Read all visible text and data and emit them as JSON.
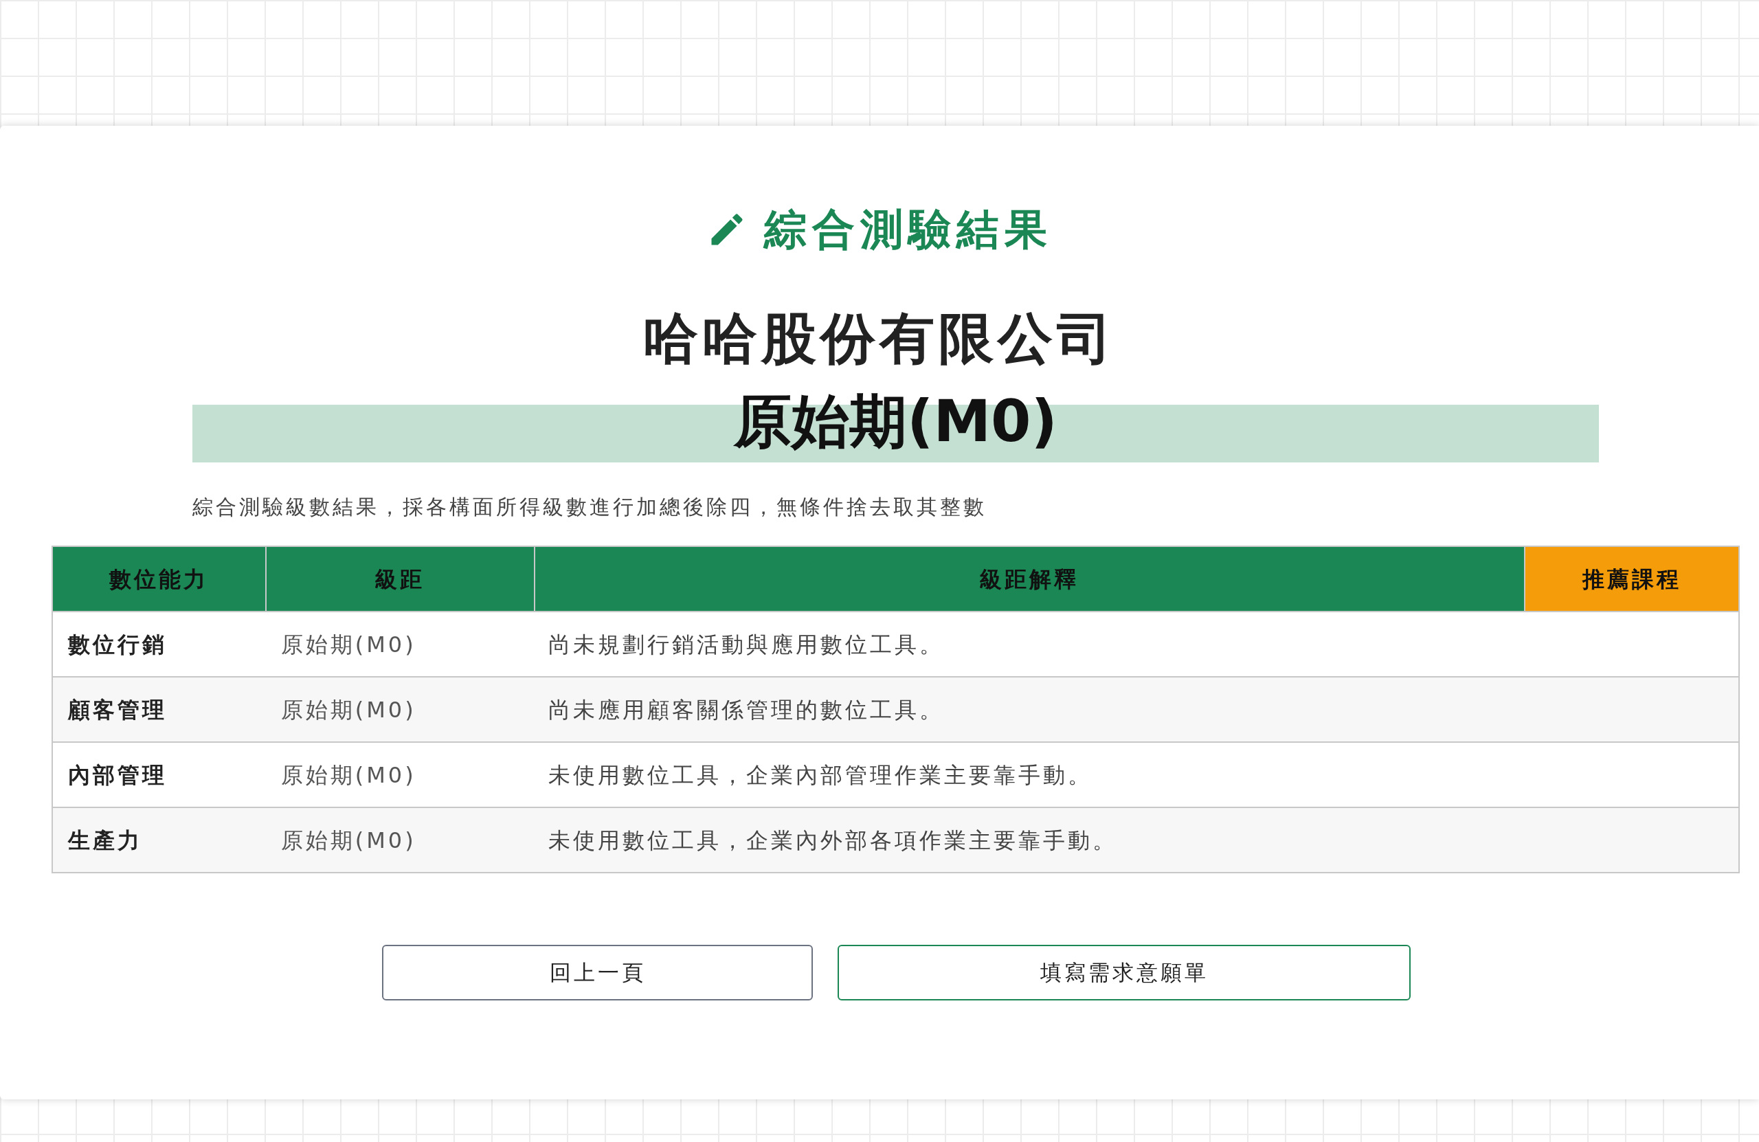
{
  "heading": {
    "title": "綜合測驗結果"
  },
  "company": "哈哈股份有限公司",
  "level": "原始期(M0)",
  "note": "綜合測驗級數結果，採各構面所得級數進行加總後除四，無條件捨去取其整數",
  "table": {
    "columns": [
      {
        "label": "數位能力",
        "color": "#1b8754"
      },
      {
        "label": "級距",
        "color": "#1b8754"
      },
      {
        "label": "級距解釋",
        "color": "#1b8754"
      },
      {
        "label": "推薦課程",
        "color": "#f59c0a"
      }
    ],
    "rows": [
      {
        "ability": "數位行銷",
        "range": "原始期(M0)",
        "explanation": "尚未規劃行銷活動與應用數位工具。"
      },
      {
        "ability": "顧客管理",
        "range": "原始期(M0)",
        "explanation": "尚未應用顧客關係管理的數位工具。"
      },
      {
        "ability": "內部管理",
        "range": "原始期(M0)",
        "explanation": "未使用數位工具，企業內部管理作業主要靠手動。"
      },
      {
        "ability": "生產力",
        "range": "原始期(M0)",
        "explanation": "未使用數位工具，企業內外部各項作業主要靠手動。"
      }
    ]
  },
  "buttons": [
    {
      "label": "回上一頁",
      "kind": "secondary"
    },
    {
      "label": "填寫需求意願單",
      "kind": "primary"
    }
  ]
}
